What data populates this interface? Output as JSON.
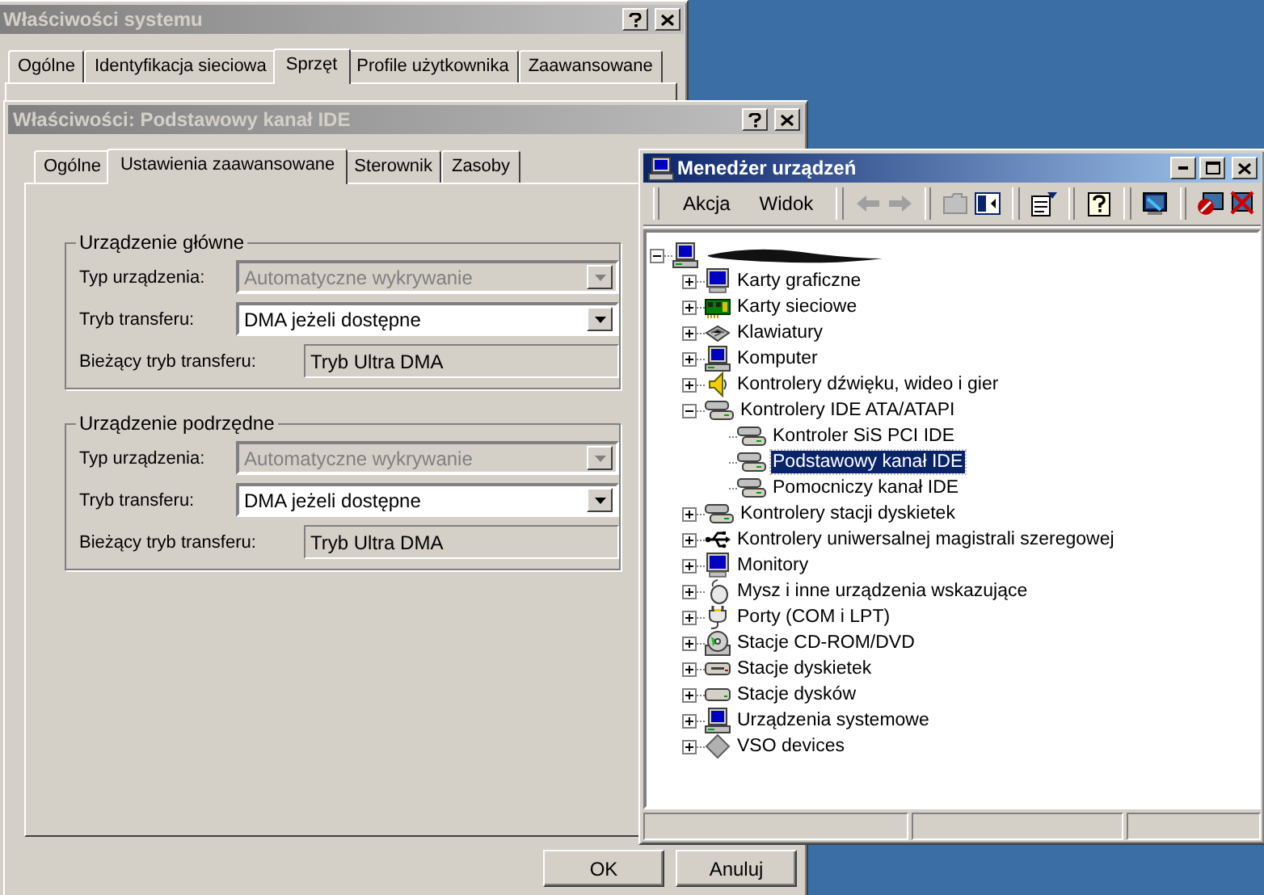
{
  "system_properties": {
    "title": "Właściwości systemu",
    "active": false,
    "tabs": [
      {
        "label": "Ogólne",
        "selected": false
      },
      {
        "label": "Identyfikacja sieciowa",
        "selected": false
      },
      {
        "label": "Sprzęt",
        "selected": true
      },
      {
        "label": "Profile użytkownika",
        "selected": false
      },
      {
        "label": "Zaawansowane",
        "selected": false
      }
    ]
  },
  "ide_properties": {
    "title": "Właściwości: Podstawowy kanał IDE",
    "active": false,
    "tabs": [
      {
        "label": "Ogólne",
        "selected": false
      },
      {
        "label": "Ustawienia zaawansowane",
        "selected": true
      },
      {
        "label": "Sterownik",
        "selected": false
      },
      {
        "label": "Zasoby",
        "selected": false
      }
    ],
    "groups": [
      {
        "title": "Urządzenie główne",
        "device_type_label": "Typ urządzenia:",
        "device_type": {
          "value": "Automatyczne wykrywanie",
          "disabled": true
        },
        "transfer_mode_label": "Tryb transferu:",
        "transfer_mode": {
          "value": "DMA jeżeli dostępne",
          "disabled": false
        },
        "current_mode_label": "Bieżący tryb transferu:",
        "current_mode": "Tryb Ultra DMA"
      },
      {
        "title": "Urządzenie podrzędne",
        "device_type_label": "Typ urządzenia:",
        "device_type": {
          "value": "Automatyczne wykrywanie",
          "disabled": true
        },
        "transfer_mode_label": "Tryb transferu:",
        "transfer_mode": {
          "value": "DMA jeżeli dostępne",
          "disabled": false
        },
        "current_mode_label": "Bieżący tryb transferu:",
        "current_mode": "Tryb Ultra DMA"
      }
    ],
    "buttons": [
      {
        "label": "OK"
      },
      {
        "label": "Anuluj"
      }
    ]
  },
  "device_manager": {
    "title": "Menedżer urządzeń",
    "active": true,
    "menu": [
      {
        "label": "Akcja"
      },
      {
        "label": "Widok"
      }
    ],
    "toolbar": [
      {
        "kind": "back",
        "disabled": true
      },
      {
        "kind": "forward",
        "disabled": true
      },
      {
        "kind": "up",
        "disabled": true
      },
      {
        "kind": "tree-toggle",
        "disabled": false
      },
      {
        "kind": "properties",
        "disabled": false
      },
      {
        "kind": "help",
        "disabled": false
      },
      {
        "kind": "scan",
        "disabled": false
      },
      {
        "kind": "disable",
        "disabled": false
      },
      {
        "kind": "uninstall",
        "disabled": false
      }
    ],
    "tree": {
      "kind": "computer",
      "selected": false,
      "expanded": true,
      "children": [
        {
          "label": "Karty graficzne",
          "kind": "display",
          "selected": false,
          "expanded": false
        },
        {
          "label": "Karty sieciowe",
          "kind": "network",
          "selected": false,
          "expanded": false
        },
        {
          "label": "Klawiatury",
          "kind": "keyboard",
          "selected": false,
          "expanded": false
        },
        {
          "label": "Komputer",
          "kind": "computer",
          "selected": false,
          "expanded": false
        },
        {
          "label": "Kontrolery dźwięku, wideo i gier",
          "kind": "sound",
          "selected": false,
          "expanded": false
        },
        {
          "label": "Kontrolery IDE ATA/ATAPI",
          "kind": "ide",
          "selected": false,
          "expanded": true,
          "children": [
            {
              "label": "Kontroler SiS PCI IDE",
              "kind": "ide",
              "selected": false
            },
            {
              "label": "Podstawowy kanał IDE",
              "kind": "ide",
              "selected": true
            },
            {
              "label": "Pomocniczy kanał IDE",
              "kind": "ide",
              "selected": false
            }
          ]
        },
        {
          "label": "Kontrolery stacji dyskietek",
          "kind": "ide",
          "selected": false,
          "expanded": false
        },
        {
          "label": "Kontrolery uniwersalnej magistrali szeregowej",
          "kind": "usb",
          "selected": false,
          "expanded": false
        },
        {
          "label": "Monitory",
          "kind": "monitor",
          "selected": false,
          "expanded": false
        },
        {
          "label": "Mysz i inne urządzenia wskazujące",
          "kind": "mouse",
          "selected": false,
          "expanded": false
        },
        {
          "label": "Porty (COM i LPT)",
          "kind": "port",
          "selected": false,
          "expanded": false
        },
        {
          "label": "Stacje CD-ROM/DVD",
          "kind": "cdrom",
          "selected": false,
          "expanded": false
        },
        {
          "label": "Stacje dyskietek",
          "kind": "floppy",
          "selected": false,
          "expanded": false
        },
        {
          "label": "Stacje dysków",
          "kind": "disk",
          "selected": false,
          "expanded": false
        },
        {
          "label": "Urządzenia systemowe",
          "kind": "computer",
          "selected": false,
          "expanded": false
        },
        {
          "label": "VSO devices",
          "kind": "diamond",
          "selected": false,
          "expanded": false
        }
      ]
    }
  }
}
